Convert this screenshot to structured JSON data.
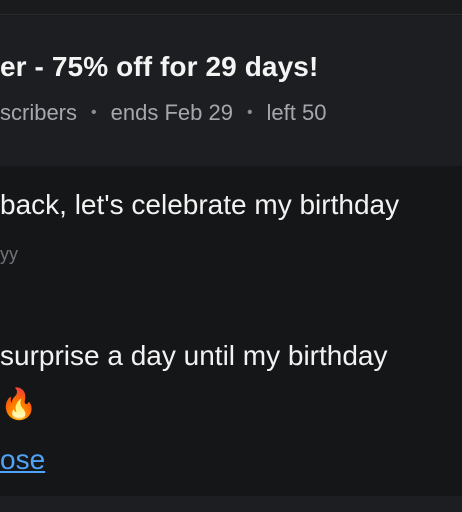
{
  "offer": {
    "title": "er - 75% off for 29 days!",
    "audience": "scribers",
    "ends": "ends Feb 29",
    "left": "left 50",
    "separator": "•"
  },
  "post": {
    "headline": "back, let's celebrate my birthday",
    "subline": "yy",
    "body": "surprise a day until my birthday",
    "emoji": "🔥",
    "close_link": "ose"
  }
}
